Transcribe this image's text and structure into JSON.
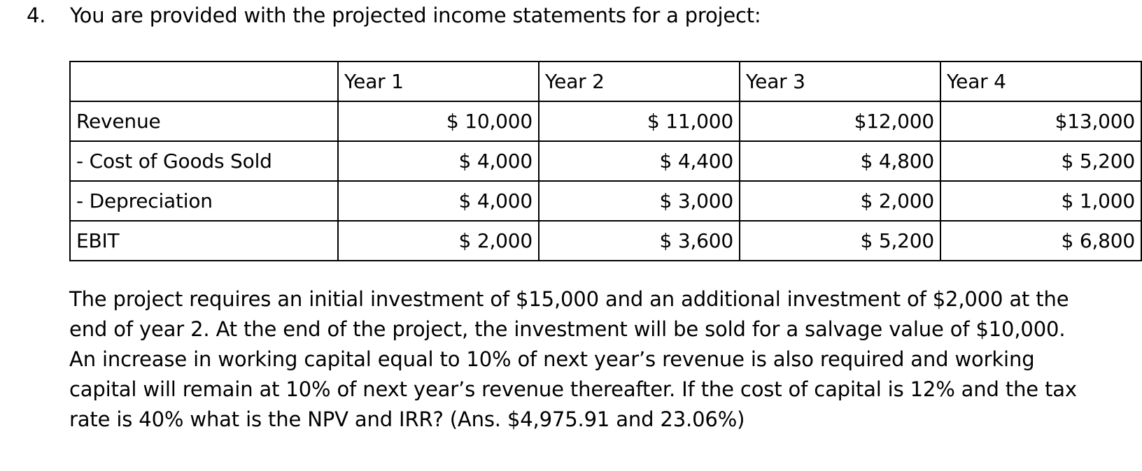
{
  "question": {
    "number": "4.",
    "prompt": "You are provided with the projected income statements for a project:"
  },
  "table": {
    "corner_label": "",
    "columns": [
      "Year 1",
      "Year 2",
      "Year 3",
      "Year 4"
    ],
    "rows": [
      {
        "label": "Revenue",
        "values": [
          "$ 10,000",
          "$ 11,000",
          "$12,000",
          "$13,000"
        ]
      },
      {
        "label": "- Cost of Goods Sold",
        "values": [
          "$ 4,000",
          "$ 4,400",
          "$ 4,800",
          "$ 5,200"
        ]
      },
      {
        "label": "- Depreciation",
        "values": [
          "$ 4,000",
          "$ 3,000",
          "$ 2,000",
          "$ 1,000"
        ]
      },
      {
        "label": "EBIT",
        "values": [
          "$ 2,000",
          "$ 3,600",
          "$ 5,200",
          "$ 6,800"
        ]
      }
    ]
  },
  "paragraph": {
    "lines": [
      "The project requires an initial investment of $15,000 and an additional investment of $2,000 at the",
      "end of year 2. At the end of the project, the investment will be sold for a salvage value of $10,000.",
      "An increase in working capital equal to 10% of next year’s revenue is also required and working",
      "capital will remain at 10% of next year’s revenue thereafter. If the cost of capital is 12% and the tax",
      "rate is 40% what is the NPV and IRR? (Ans. $4,975.91 and 23.06%)"
    ]
  },
  "chart_data": {
    "type": "table",
    "title": "Projected income statements for a project",
    "categories": [
      "Year 1",
      "Year 2",
      "Year 3",
      "Year 4"
    ],
    "series": [
      {
        "name": "Revenue",
        "values": [
          10000,
          11000,
          12000,
          13000
        ]
      },
      {
        "name": "- Cost of Goods Sold",
        "values": [
          4000,
          4400,
          4800,
          5200
        ]
      },
      {
        "name": "- Depreciation",
        "values": [
          4000,
          3000,
          2000,
          1000
        ]
      },
      {
        "name": "EBIT",
        "values": [
          2000,
          3600,
          5200,
          6800
        ]
      }
    ],
    "xlabel": "",
    "ylabel": "",
    "grid": true,
    "annotations": {
      "initial_investment": 15000,
      "additional_investment_year2": 2000,
      "salvage_value": 10000,
      "working_capital_pct_of_next_year_revenue": "10%",
      "cost_of_capital": "12%",
      "tax_rate": "40%",
      "answer_npv": "$4,975.91",
      "answer_irr": "23.06%"
    }
  }
}
